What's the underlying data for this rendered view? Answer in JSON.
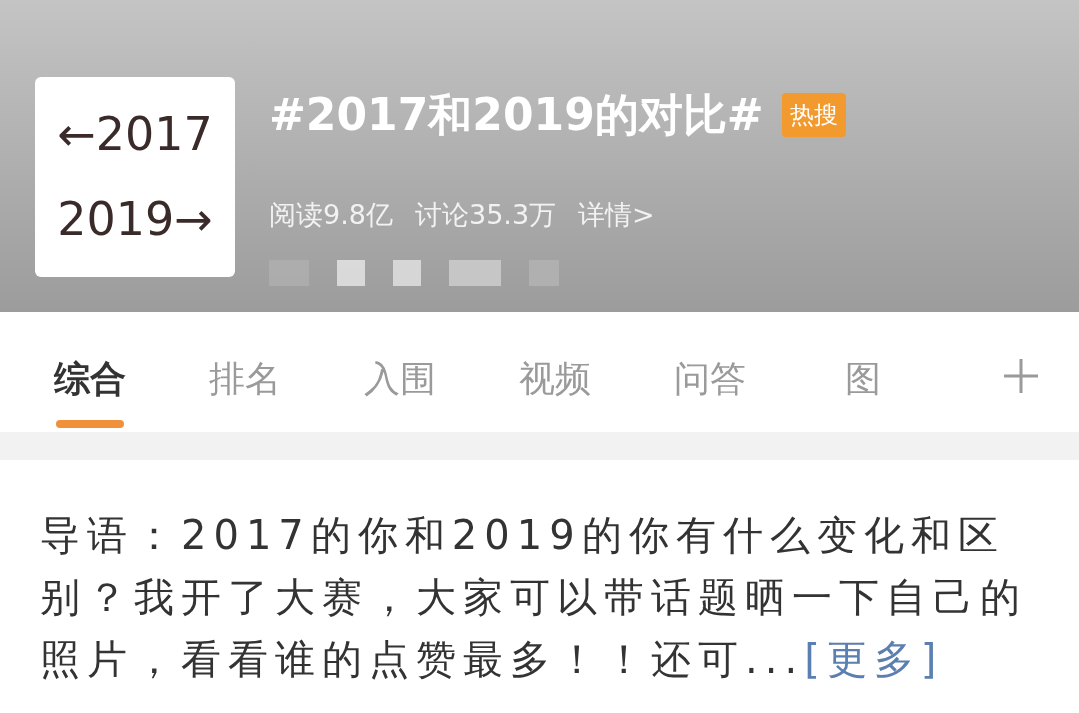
{
  "header": {
    "cover_lines": [
      "←2017",
      "2019→"
    ],
    "title": "#2017和2019的对比#",
    "badge": "热搜",
    "stats": [
      {
        "label": "阅读9.8亿"
      },
      {
        "label": "讨论35.3万"
      },
      {
        "label": "详情>"
      }
    ]
  },
  "tabs": [
    {
      "label": "综合",
      "selected": true
    },
    {
      "label": "排名",
      "selected": false
    },
    {
      "label": "入围",
      "selected": false
    },
    {
      "label": "视频",
      "selected": false
    },
    {
      "label": "问答",
      "selected": false
    },
    {
      "label": "图",
      "selected": false
    }
  ],
  "lead": {
    "text": "导语：2017的你和2019的你有什么变化和区别？我开了大赛，大家可以带话题晒一下自己的照片，看看谁的点赞最多！！还可...",
    "more_link": "[更多]"
  }
}
